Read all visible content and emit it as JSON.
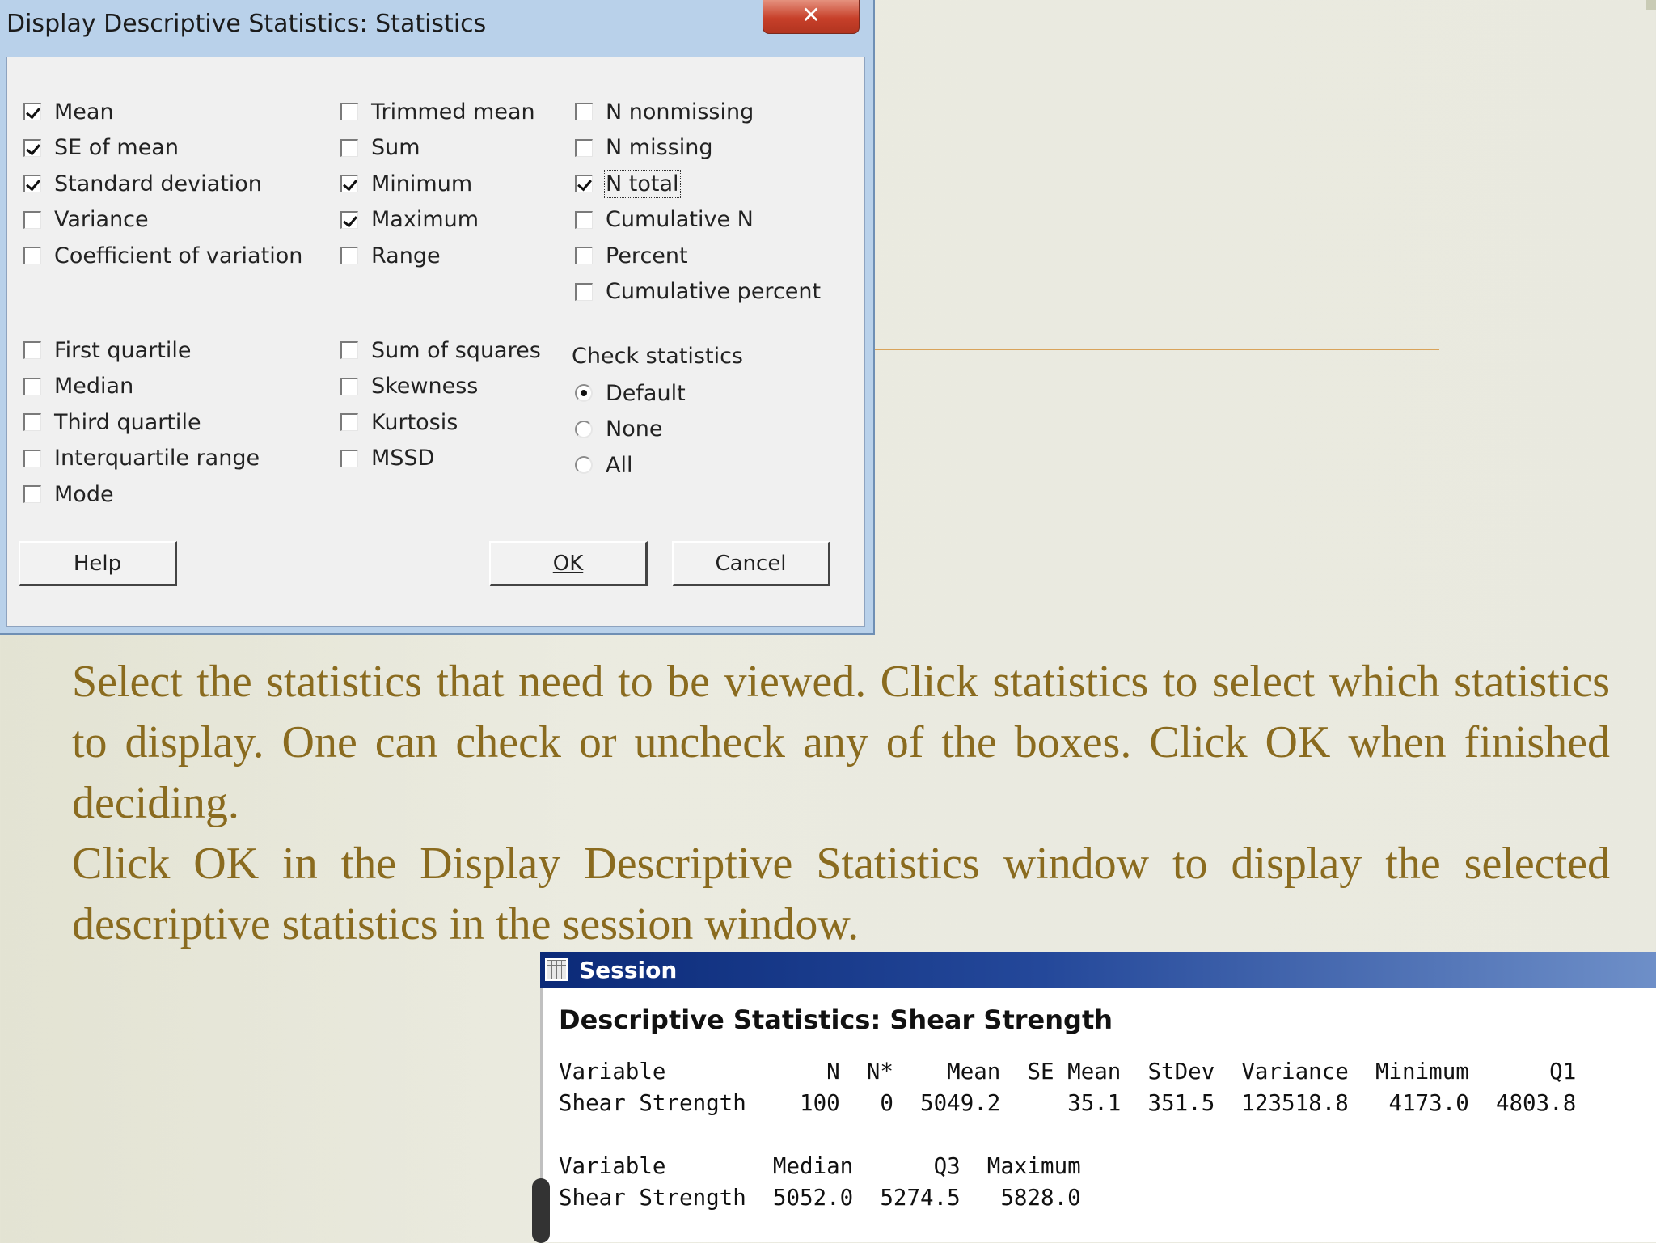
{
  "dialog": {
    "title": "Display Descriptive Statistics: Statistics",
    "close_label": "✕",
    "col1_top": [
      {
        "label": "Mean",
        "checked": true
      },
      {
        "label": "SE of mean",
        "checked": true
      },
      {
        "label": "Standard deviation",
        "checked": true
      },
      {
        "label": "Variance",
        "checked": false
      },
      {
        "label": "Coefficient of variation",
        "checked": false
      }
    ],
    "col1_bottom": [
      {
        "label": "First quartile",
        "checked": false
      },
      {
        "label": "Median",
        "checked": false
      },
      {
        "label": "Third quartile",
        "checked": false
      },
      {
        "label": "Interquartile range",
        "checked": false
      },
      {
        "label": "Mode",
        "checked": false
      }
    ],
    "col2_top": [
      {
        "label": "Trimmed mean",
        "checked": false
      },
      {
        "label": "Sum",
        "checked": false
      },
      {
        "label": "Minimum",
        "checked": true
      },
      {
        "label": "Maximum",
        "checked": true
      },
      {
        "label": "Range",
        "checked": false
      }
    ],
    "col2_bottom": [
      {
        "label": "Sum of squares",
        "checked": false
      },
      {
        "label": "Skewness",
        "checked": false
      },
      {
        "label": "Kurtosis",
        "checked": false
      },
      {
        "label": "MSSD",
        "checked": false
      }
    ],
    "col3_top": [
      {
        "label": "N nonmissing",
        "checked": false
      },
      {
        "label": "N missing",
        "checked": false
      },
      {
        "label": "N total",
        "checked": true
      },
      {
        "label": "Cumulative N",
        "checked": false
      },
      {
        "label": "Percent",
        "checked": false
      },
      {
        "label": "Cumulative percent",
        "checked": false
      }
    ],
    "check_statistics": {
      "label": "Check statistics",
      "options": [
        "Default",
        "None",
        "All"
      ],
      "selected": "Default"
    },
    "buttons": {
      "help": "Help",
      "ok": "OK",
      "cancel": "Cancel"
    }
  },
  "instructions": {
    "line1": "Select the statistics that need to be viewed. Click statistics to select which statistics to display. One can check or uncheck any of the boxes. Click OK when finished deciding.",
    "line2": "Click OK in the Display Descriptive Statistics window to display the selected descriptive statistics in the session window."
  },
  "session": {
    "title": "Session",
    "heading": "Descriptive Statistics: Shear Strength",
    "table1_header": "Variable            N  N*    Mean  SE Mean  StDev  Variance  Minimum      Q1",
    "table1_row": "Shear Strength    100   0  5049.2     35.1  351.5  123518.8   4173.0  4803.8",
    "table2_header": "Variable        Median      Q3  Maximum",
    "table2_row": "Shear Strength  5052.0  5274.5   5828.0"
  },
  "colors": {
    "instruction_text": "#8a6b1f",
    "session_titlebar": "#0b2a78",
    "close_button": "#c7402a"
  }
}
